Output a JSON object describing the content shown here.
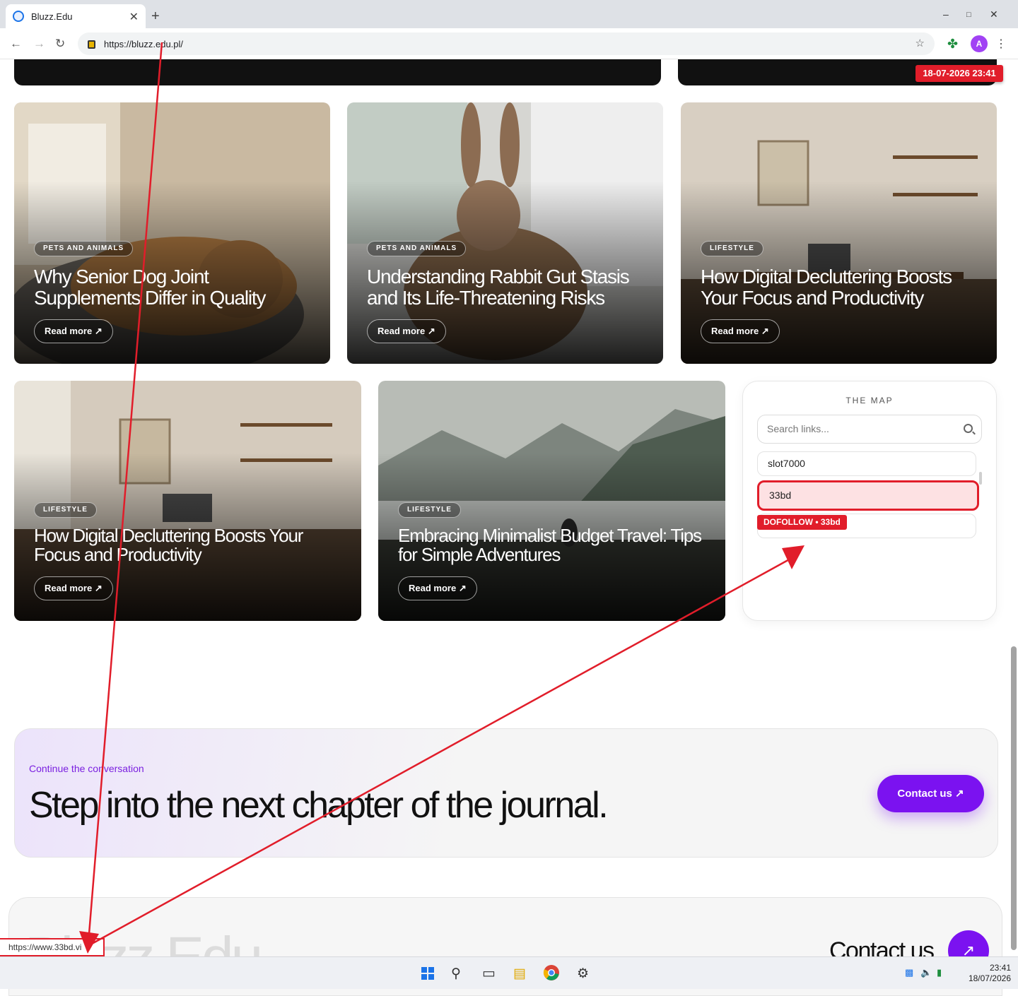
{
  "browser": {
    "tab_title": "Bluzz.Edu",
    "url": "https://bluzz.edu.pl/",
    "avatar_letter": "A",
    "status_url": "https://www.33bd.vi"
  },
  "stamp": "18-07-2026 23:41",
  "cards_row1": [
    {
      "category": "PETS AND ANIMALS",
      "title": "Why Senior Dog Joint Supplements Differ in Quality",
      "cta": "Read more"
    },
    {
      "category": "PETS AND ANIMALS",
      "title": "Understanding Rabbit Gut Stasis and Its Life-Threatening Risks",
      "cta": "Read more"
    },
    {
      "category": "LIFESTYLE",
      "title": "How Digital Decluttering Boosts Your Focus and Productivity",
      "cta": "Read more"
    }
  ],
  "cards_row2": [
    {
      "category": "LIFESTYLE",
      "title": "How Digital Decluttering Boosts Your Focus and Productivity",
      "cta": "Read more"
    },
    {
      "category": "LIFESTYLE",
      "title": "Embracing Minimalist Budget Travel: Tips for Simple Adventures",
      "cta": "Read more"
    }
  ],
  "map": {
    "title": "THE MAP",
    "search_placeholder": "Search links...",
    "links": [
      "slot7000",
      "33bd",
      ""
    ],
    "badge": "DOFOLLOW • 33bd"
  },
  "cta": {
    "kicker": "Continue the conversation",
    "headline": "Step into the next chapter of the journal.",
    "button": "Contact us"
  },
  "footer": {
    "logo": "Bluzz.Edu",
    "contact": "Contact us"
  },
  "taskbar": {
    "time": "23:41",
    "date": "18/07/2026"
  },
  "colors": {
    "accent": "#7b12f0",
    "annotation_red": "#e11d2a"
  }
}
